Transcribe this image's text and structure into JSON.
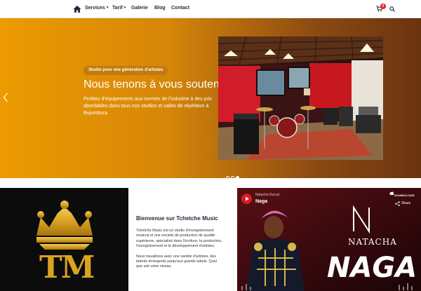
{
  "nav": {
    "items": [
      {
        "label": "Services",
        "has_dropdown": true
      },
      {
        "label": "Tarif",
        "has_dropdown": true
      },
      {
        "label": "Galerie",
        "has_dropdown": false
      },
      {
        "label": "Blog",
        "has_dropdown": false
      },
      {
        "label": "Contact",
        "has_dropdown": false
      }
    ],
    "caret": "▾",
    "cart_count": "0",
    "icons": [
      "home-icon",
      "cart-icon",
      "search-icon"
    ]
  },
  "hero": {
    "tagline": "Studio pour une génération d'artistes",
    "title": "Nous tenons à vous soutenir",
    "description": "Profitez d'équipements aux normes de l'industrie à des prix abordables dans tous nos studios et salles de répétition à Bujumbura.",
    "slides_total": 3,
    "active_slide": 3,
    "gradient": [
      "#ec9b00",
      "#6a3310"
    ]
  },
  "about": {
    "logo_text": "TM",
    "heading": "Bienvenue sur Tchetche Music",
    "paragraphs": [
      "Tchetche Music est un studio d'enregistrement musical et une société de production de qualité supérieure, spécialisé dans l'écriture, la production, l'enregistrement et le développement d'artistes.",
      "Nous travaillons avec une variété d'artistes, des talents émergents jusqu'aux grands labels. Quel que soit votre niveau"
    ]
  },
  "video": {
    "channel": "Natacha Ruruzi",
    "song": "Naga",
    "soundcloud_label": "SOUNDCLOUD",
    "share_label": "Share",
    "cover_artist": "NATACHA",
    "cover_title": "NAGA",
    "cover_letter": "N"
  }
}
